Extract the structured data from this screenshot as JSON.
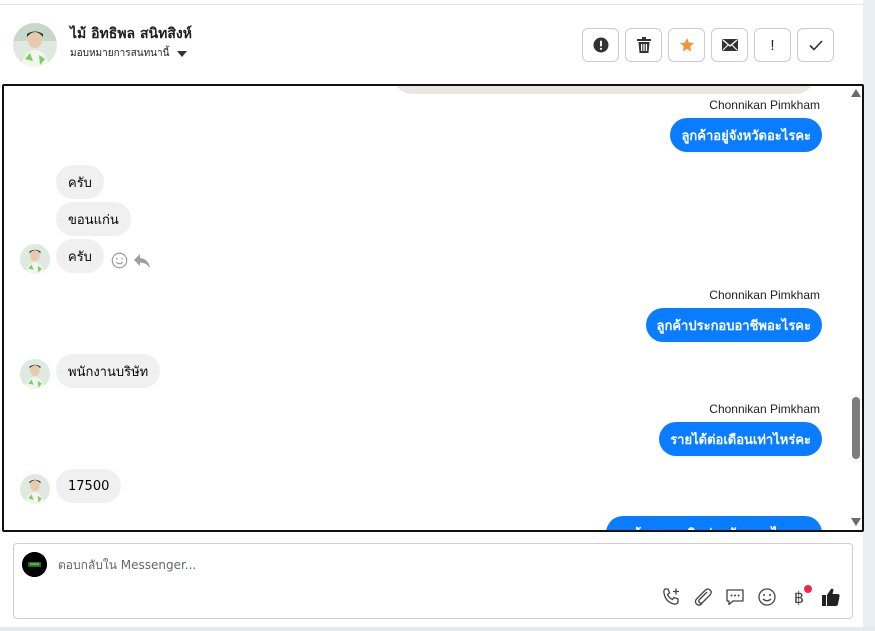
{
  "header": {
    "contact_name": "ไม้ อิทธิพล สนิทสิงห์",
    "assign_label": "มอบหมายการสนทนานี้",
    "toolbar": [
      {
        "name": "alert-button",
        "icon": "alert-circle-icon"
      },
      {
        "name": "delete-button",
        "icon": "trash-icon"
      },
      {
        "name": "star-button",
        "icon": "star-icon",
        "color": "#f7923b"
      },
      {
        "name": "email-button",
        "icon": "envelope-icon"
      },
      {
        "name": "spam-button",
        "icon": "exclamation-icon",
        "label": "!"
      },
      {
        "name": "done-button",
        "icon": "checkmark-icon"
      }
    ]
  },
  "messages": {
    "m1": {
      "sender": "Chonnikan Pimkham",
      "text": "ลูกค้าอยู่จังหวัดอะไรคะ"
    },
    "m2": {
      "text": "ครับ"
    },
    "m3": {
      "text": "ขอนแก่น"
    },
    "m4": {
      "text": "ครับ"
    },
    "m5": {
      "sender": "Chonnikan Pimkham",
      "text": "ลูกค้าประกอบอาชีพอะไรคะ"
    },
    "m6": {
      "text": "พนักงานบริษัท"
    },
    "m7": {
      "sender": "Chonnikan Pimkham",
      "text": "รายได้ต่อเดือนเท่าไหร่คะ"
    },
    "m8": {
      "text": "17500"
    },
    "m9": {
      "text": "ลูกค้าสะดวกติดต่อกลับเวลาไหนคะ"
    }
  },
  "composer": {
    "placeholder": "ตอบกลับใน Messenger...",
    "tools": [
      "phone-add-icon",
      "paperclip-icon",
      "saved-reply-icon",
      "emoji-icon",
      "baht-icon",
      "thumbs-up-icon"
    ],
    "baht_symbol": "฿"
  },
  "colors": {
    "outgoing_bubble": "#0a7cff",
    "incoming_bubble": "#f0f0f0",
    "star": "#f7923b",
    "notification_dot": "#f02849"
  }
}
